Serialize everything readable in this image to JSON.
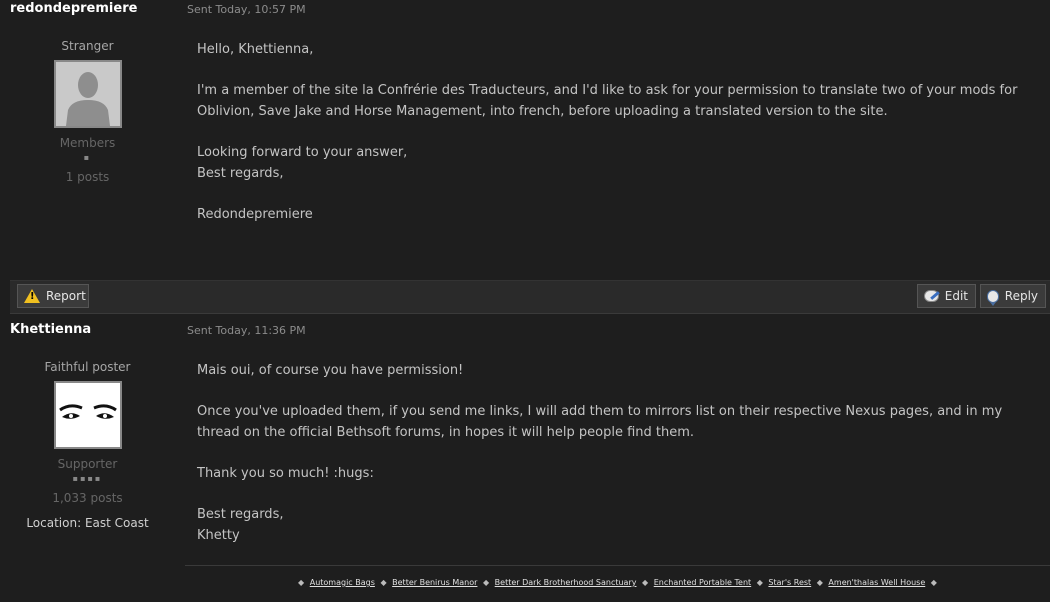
{
  "posts": [
    {
      "author": "redondepremiere",
      "sent": "Sent Today, 10:57 PM",
      "rank": "Stranger",
      "group": "Members",
      "pips": "▪",
      "posts": "1 posts",
      "body": [
        "Hello, Khettienna,",
        "I'm a member of the site la Confrérie des Traducteurs, and I'd like to ask for your permission to translate two of your mods for Oblivion, Save Jake and Horse Management, into french, before uploading a translated version to the site.",
        "Looking forward to your answer,",
        "Best regards,",
        "Redondepremiere"
      ]
    },
    {
      "author": "Khettienna",
      "sent": "Sent Today, 11:36 PM",
      "rank": "Faithful poster",
      "group": "Supporter",
      "pips": "▪▪▪▪",
      "posts": "1,033 posts",
      "location_label": "Location:",
      "location": "East Coast",
      "body": [
        "Mais oui, of course you have permission!",
        "Once you've uploaded them, if you send me links, I will add them to mirrors list on their respective Nexus pages, and in my thread on the official Bethsoft forums, in hopes it will help people find them.",
        "Thank you so much!  :hugs:",
        "Best regards,",
        "Khetty"
      ]
    }
  ],
  "toolbar": {
    "report_label": "Report",
    "edit_label": "Edit",
    "reply_label": "Reply"
  },
  "signature": {
    "separator": "◆",
    "links": [
      "Automagic Bags",
      "Better Benirus Manor",
      "Better Dark Brotherhood Sanctuary",
      "Enchanted Portable Tent",
      "Star's Rest",
      "Amen'thalas Well House"
    ]
  },
  "colors": {
    "background": "#1e1e1e",
    "toolbar": "#2a2a2a",
    "button": "#3b3b3b",
    "text": "#c4c4c4",
    "warning": "#f0c020"
  }
}
